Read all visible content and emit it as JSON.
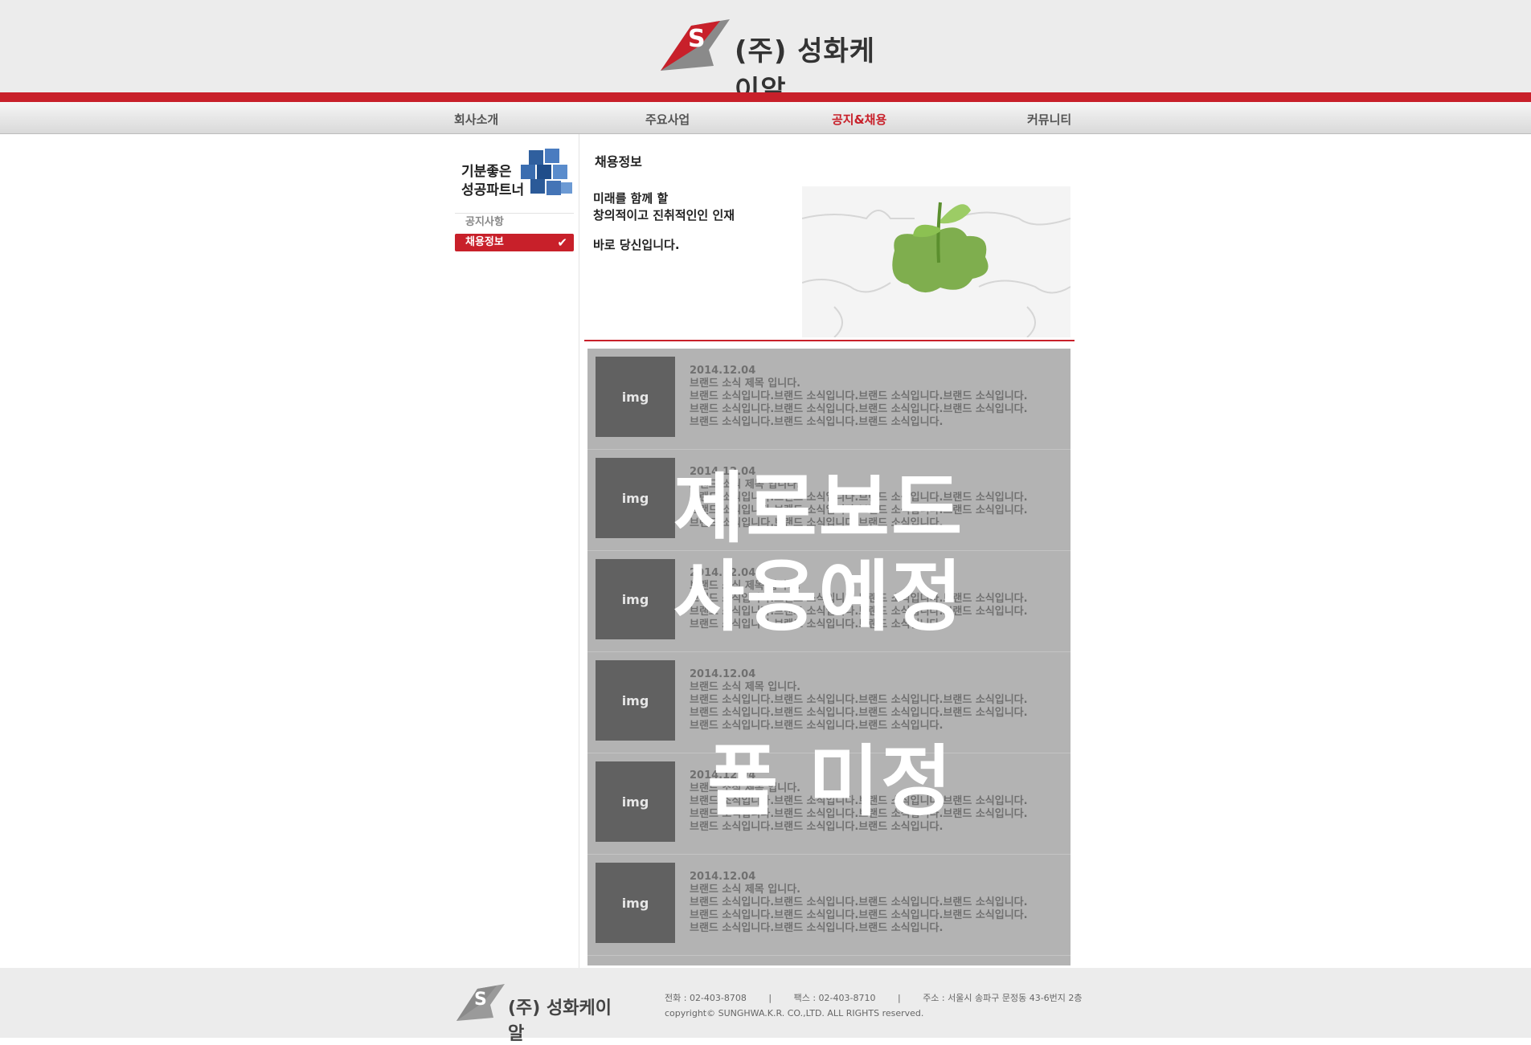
{
  "header": {
    "logo_text": "(주) 성화케이알"
  },
  "nav": {
    "items": [
      {
        "label": "회사소개"
      },
      {
        "label": "주요사업"
      },
      {
        "label": "공지&채용"
      },
      {
        "label": "커뮤니티"
      }
    ]
  },
  "sidebar": {
    "banner_line1": "기분좋은",
    "banner_line2": "성공파트너",
    "items": [
      {
        "label": "공지사항"
      },
      {
        "label": "채용정보"
      }
    ],
    "check_glyph": "✔"
  },
  "main": {
    "title": "채용정보",
    "intro_line1": "미래를 함께 할",
    "intro_line2": "창의적이고 진취적인인 인재",
    "intro_line3": "바로 당신입니다.",
    "posts": [
      {
        "thumb": "img",
        "date": "2014.12.04",
        "title": "브랜드 소식 제목 입니다.",
        "body": "브랜드 소식입니다.브랜드 소식입니다.브랜드 소식입니다.브랜드 소식입니다.\n브랜드 소식입니다.브랜드 소식입니다.브랜드 소식입니다.브랜드 소식입니다.\n브랜드 소식입니다.브랜드 소식입니다.브랜드 소식입니다."
      },
      {
        "thumb": "img",
        "date": "2014.12.04",
        "title": "브랜드 소식 제목 입니다.",
        "body": "브랜드 소식입니다.브랜드 소식입니다.브랜드 소식입니다.브랜드 소식입니다.\n브랜드 소식입니다.브랜드 소식입니다.브랜드 소식입니다.브랜드 소식입니다.\n브랜드 소식입니다.브랜드 소식입니다.브랜드 소식입니다."
      },
      {
        "thumb": "img",
        "date": "2014.12.04",
        "title": "브랜드 소식 제목 입니다.",
        "body": "브랜드 소식입니다.브랜드 소식입니다.브랜드 소식입니다.브랜드 소식입니다.\n브랜드 소식입니다.브랜드 소식입니다.브랜드 소식입니다.브랜드 소식입니다.\n브랜드 소식입니다.브랜드 소식입니다.브랜드 소식입니다."
      },
      {
        "thumb": "img",
        "date": "2014.12.04",
        "title": "브랜드 소식 제목 입니다.",
        "body": "브랜드 소식입니다.브랜드 소식입니다.브랜드 소식입니다.브랜드 소식입니다.\n브랜드 소식입니다.브랜드 소식입니다.브랜드 소식입니다.브랜드 소식입니다.\n브랜드 소식입니다.브랜드 소식입니다.브랜드 소식입니다."
      },
      {
        "thumb": "img",
        "date": "2014.12.04",
        "title": "브랜드 소식 제목 입니다.",
        "body": "브랜드 소식입니다.브랜드 소식입니다.브랜드 소식입니다.브랜드 소식입니다.\n브랜드 소식입니다.브랜드 소식입니다.브랜드 소식입니다.브랜드 소식입니다.\n브랜드 소식입니다.브랜드 소식입니다.브랜드 소식입니다."
      },
      {
        "thumb": "img",
        "date": "2014.12.04",
        "title": "브랜드 소식 제목 입니다.",
        "body": "브랜드 소식입니다.브랜드 소식입니다.브랜드 소식입니다.브랜드 소식입니다.\n브랜드 소식입니다.브랜드 소식입니다.브랜드 소식입니다.브랜드 소식입니다.\n브랜드 소식입니다.브랜드 소식입니다.브랜드 소식입니다."
      }
    ],
    "overlay_line1": "제로보드",
    "overlay_line2": "사용예정",
    "overlay_line3": "폼 미정"
  },
  "footer": {
    "logo_text": "(주) 성화케이알",
    "phone": "전화 : 02-403-8708",
    "fax": "팩스 : 02-403-8710",
    "address": "주소 : 서울시 송파구 문정동 43-6번지 2층",
    "separator": "|",
    "copyright": "copyright© SUNGHWA.K.R. CO.,LTD. ALL RIGHTS reserved."
  },
  "colors": {
    "accent": "#c8202a",
    "board": "#b3b3b3",
    "thumb": "#616161"
  }
}
